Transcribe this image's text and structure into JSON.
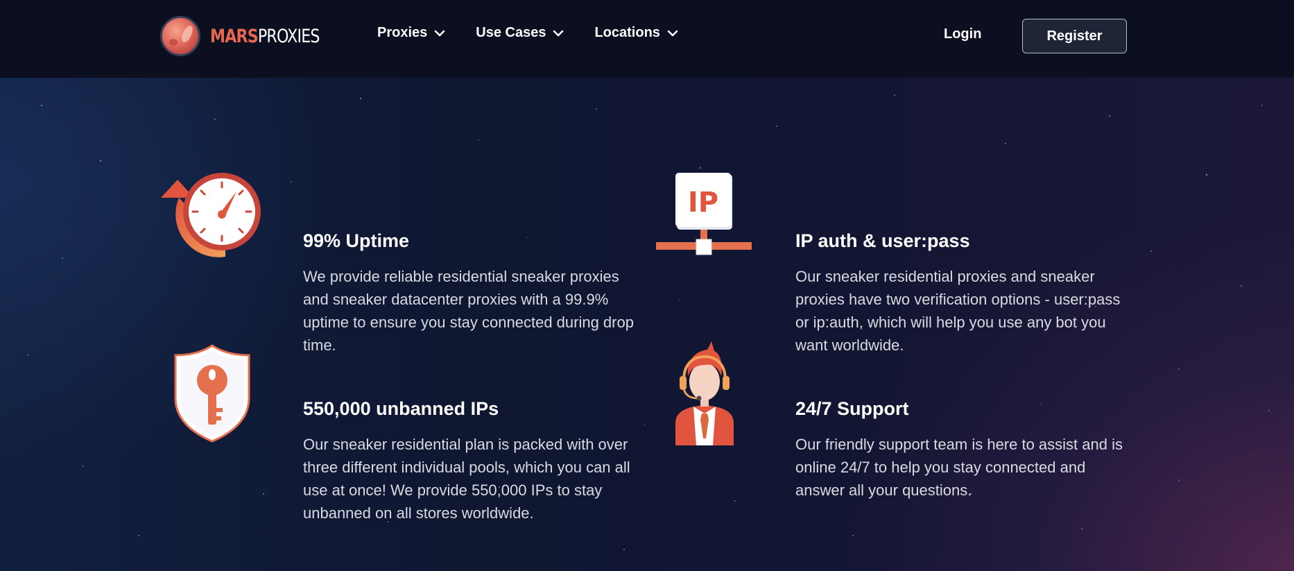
{
  "brand": {
    "logo_mars": "MARS",
    "logo_proxies": "PROXIES"
  },
  "nav": {
    "items": [
      {
        "label": "Proxies",
        "icon": "chevron-down-icon"
      },
      {
        "label": "Use Cases",
        "icon": "chevron-down-icon"
      },
      {
        "label": "Locations",
        "icon": "chevron-down-icon"
      }
    ],
    "login_label": "Login",
    "register_label": "Register"
  },
  "features": [
    {
      "title": "99% Uptime",
      "text": "We provide reliable residential sneaker proxies and sneaker datacenter proxies with a 99.9% uptime to ensure you stay connected during drop time.",
      "icon": "speedometer-icon"
    },
    {
      "title": "IP auth & user:pass",
      "text": "Our sneaker residential proxies and sneaker proxies have two verification options - user:pass or ip:auth, which will help you use any bot you want worldwide.",
      "icon": "ip-network-icon",
      "icon_label": "IP"
    },
    {
      "title": "550,000 unbanned IPs",
      "text": "Our sneaker residential plan is packed with over three different individual pools, which you can all use at once! We provide 550,000 IPs to stay unbanned on all stores worldwide.",
      "icon": "shield-key-icon"
    },
    {
      "title": "24/7 Support",
      "text": "Our friendly support team is here to assist and is online 24/7 to help you stay connected and answer all your questions.",
      "icon": "support-agent-icon"
    }
  ],
  "colors": {
    "accent": "#e8684f",
    "nav_bg": "#0b0f20",
    "hero_bg": "#0f1731",
    "text_muted": "#d9dbe3"
  }
}
